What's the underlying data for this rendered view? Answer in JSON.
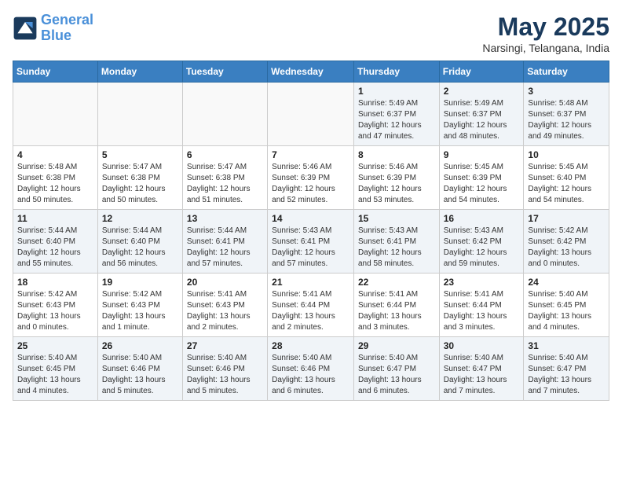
{
  "header": {
    "logo_line1": "General",
    "logo_line2": "Blue",
    "month": "May 2025",
    "location": "Narsingi, Telangana, India"
  },
  "weekdays": [
    "Sunday",
    "Monday",
    "Tuesday",
    "Wednesday",
    "Thursday",
    "Friday",
    "Saturday"
  ],
  "weeks": [
    [
      {
        "day": "",
        "info": ""
      },
      {
        "day": "",
        "info": ""
      },
      {
        "day": "",
        "info": ""
      },
      {
        "day": "",
        "info": ""
      },
      {
        "day": "1",
        "info": "Sunrise: 5:49 AM\nSunset: 6:37 PM\nDaylight: 12 hours\nand 47 minutes."
      },
      {
        "day": "2",
        "info": "Sunrise: 5:49 AM\nSunset: 6:37 PM\nDaylight: 12 hours\nand 48 minutes."
      },
      {
        "day": "3",
        "info": "Sunrise: 5:48 AM\nSunset: 6:37 PM\nDaylight: 12 hours\nand 49 minutes."
      }
    ],
    [
      {
        "day": "4",
        "info": "Sunrise: 5:48 AM\nSunset: 6:38 PM\nDaylight: 12 hours\nand 50 minutes."
      },
      {
        "day": "5",
        "info": "Sunrise: 5:47 AM\nSunset: 6:38 PM\nDaylight: 12 hours\nand 50 minutes."
      },
      {
        "day": "6",
        "info": "Sunrise: 5:47 AM\nSunset: 6:38 PM\nDaylight: 12 hours\nand 51 minutes."
      },
      {
        "day": "7",
        "info": "Sunrise: 5:46 AM\nSunset: 6:39 PM\nDaylight: 12 hours\nand 52 minutes."
      },
      {
        "day": "8",
        "info": "Sunrise: 5:46 AM\nSunset: 6:39 PM\nDaylight: 12 hours\nand 53 minutes."
      },
      {
        "day": "9",
        "info": "Sunrise: 5:45 AM\nSunset: 6:39 PM\nDaylight: 12 hours\nand 54 minutes."
      },
      {
        "day": "10",
        "info": "Sunrise: 5:45 AM\nSunset: 6:40 PM\nDaylight: 12 hours\nand 54 minutes."
      }
    ],
    [
      {
        "day": "11",
        "info": "Sunrise: 5:44 AM\nSunset: 6:40 PM\nDaylight: 12 hours\nand 55 minutes."
      },
      {
        "day": "12",
        "info": "Sunrise: 5:44 AM\nSunset: 6:40 PM\nDaylight: 12 hours\nand 56 minutes."
      },
      {
        "day": "13",
        "info": "Sunrise: 5:44 AM\nSunset: 6:41 PM\nDaylight: 12 hours\nand 57 minutes."
      },
      {
        "day": "14",
        "info": "Sunrise: 5:43 AM\nSunset: 6:41 PM\nDaylight: 12 hours\nand 57 minutes."
      },
      {
        "day": "15",
        "info": "Sunrise: 5:43 AM\nSunset: 6:41 PM\nDaylight: 12 hours\nand 58 minutes."
      },
      {
        "day": "16",
        "info": "Sunrise: 5:43 AM\nSunset: 6:42 PM\nDaylight: 12 hours\nand 59 minutes."
      },
      {
        "day": "17",
        "info": "Sunrise: 5:42 AM\nSunset: 6:42 PM\nDaylight: 13 hours\nand 0 minutes."
      }
    ],
    [
      {
        "day": "18",
        "info": "Sunrise: 5:42 AM\nSunset: 6:43 PM\nDaylight: 13 hours\nand 0 minutes."
      },
      {
        "day": "19",
        "info": "Sunrise: 5:42 AM\nSunset: 6:43 PM\nDaylight: 13 hours\nand 1 minute."
      },
      {
        "day": "20",
        "info": "Sunrise: 5:41 AM\nSunset: 6:43 PM\nDaylight: 13 hours\nand 2 minutes."
      },
      {
        "day": "21",
        "info": "Sunrise: 5:41 AM\nSunset: 6:44 PM\nDaylight: 13 hours\nand 2 minutes."
      },
      {
        "day": "22",
        "info": "Sunrise: 5:41 AM\nSunset: 6:44 PM\nDaylight: 13 hours\nand 3 minutes."
      },
      {
        "day": "23",
        "info": "Sunrise: 5:41 AM\nSunset: 6:44 PM\nDaylight: 13 hours\nand 3 minutes."
      },
      {
        "day": "24",
        "info": "Sunrise: 5:40 AM\nSunset: 6:45 PM\nDaylight: 13 hours\nand 4 minutes."
      }
    ],
    [
      {
        "day": "25",
        "info": "Sunrise: 5:40 AM\nSunset: 6:45 PM\nDaylight: 13 hours\nand 4 minutes."
      },
      {
        "day": "26",
        "info": "Sunrise: 5:40 AM\nSunset: 6:46 PM\nDaylight: 13 hours\nand 5 minutes."
      },
      {
        "day": "27",
        "info": "Sunrise: 5:40 AM\nSunset: 6:46 PM\nDaylight: 13 hours\nand 5 minutes."
      },
      {
        "day": "28",
        "info": "Sunrise: 5:40 AM\nSunset: 6:46 PM\nDaylight: 13 hours\nand 6 minutes."
      },
      {
        "day": "29",
        "info": "Sunrise: 5:40 AM\nSunset: 6:47 PM\nDaylight: 13 hours\nand 6 minutes."
      },
      {
        "day": "30",
        "info": "Sunrise: 5:40 AM\nSunset: 6:47 PM\nDaylight: 13 hours\nand 7 minutes."
      },
      {
        "day": "31",
        "info": "Sunrise: 5:40 AM\nSunset: 6:47 PM\nDaylight: 13 hours\nand 7 minutes."
      }
    ]
  ]
}
